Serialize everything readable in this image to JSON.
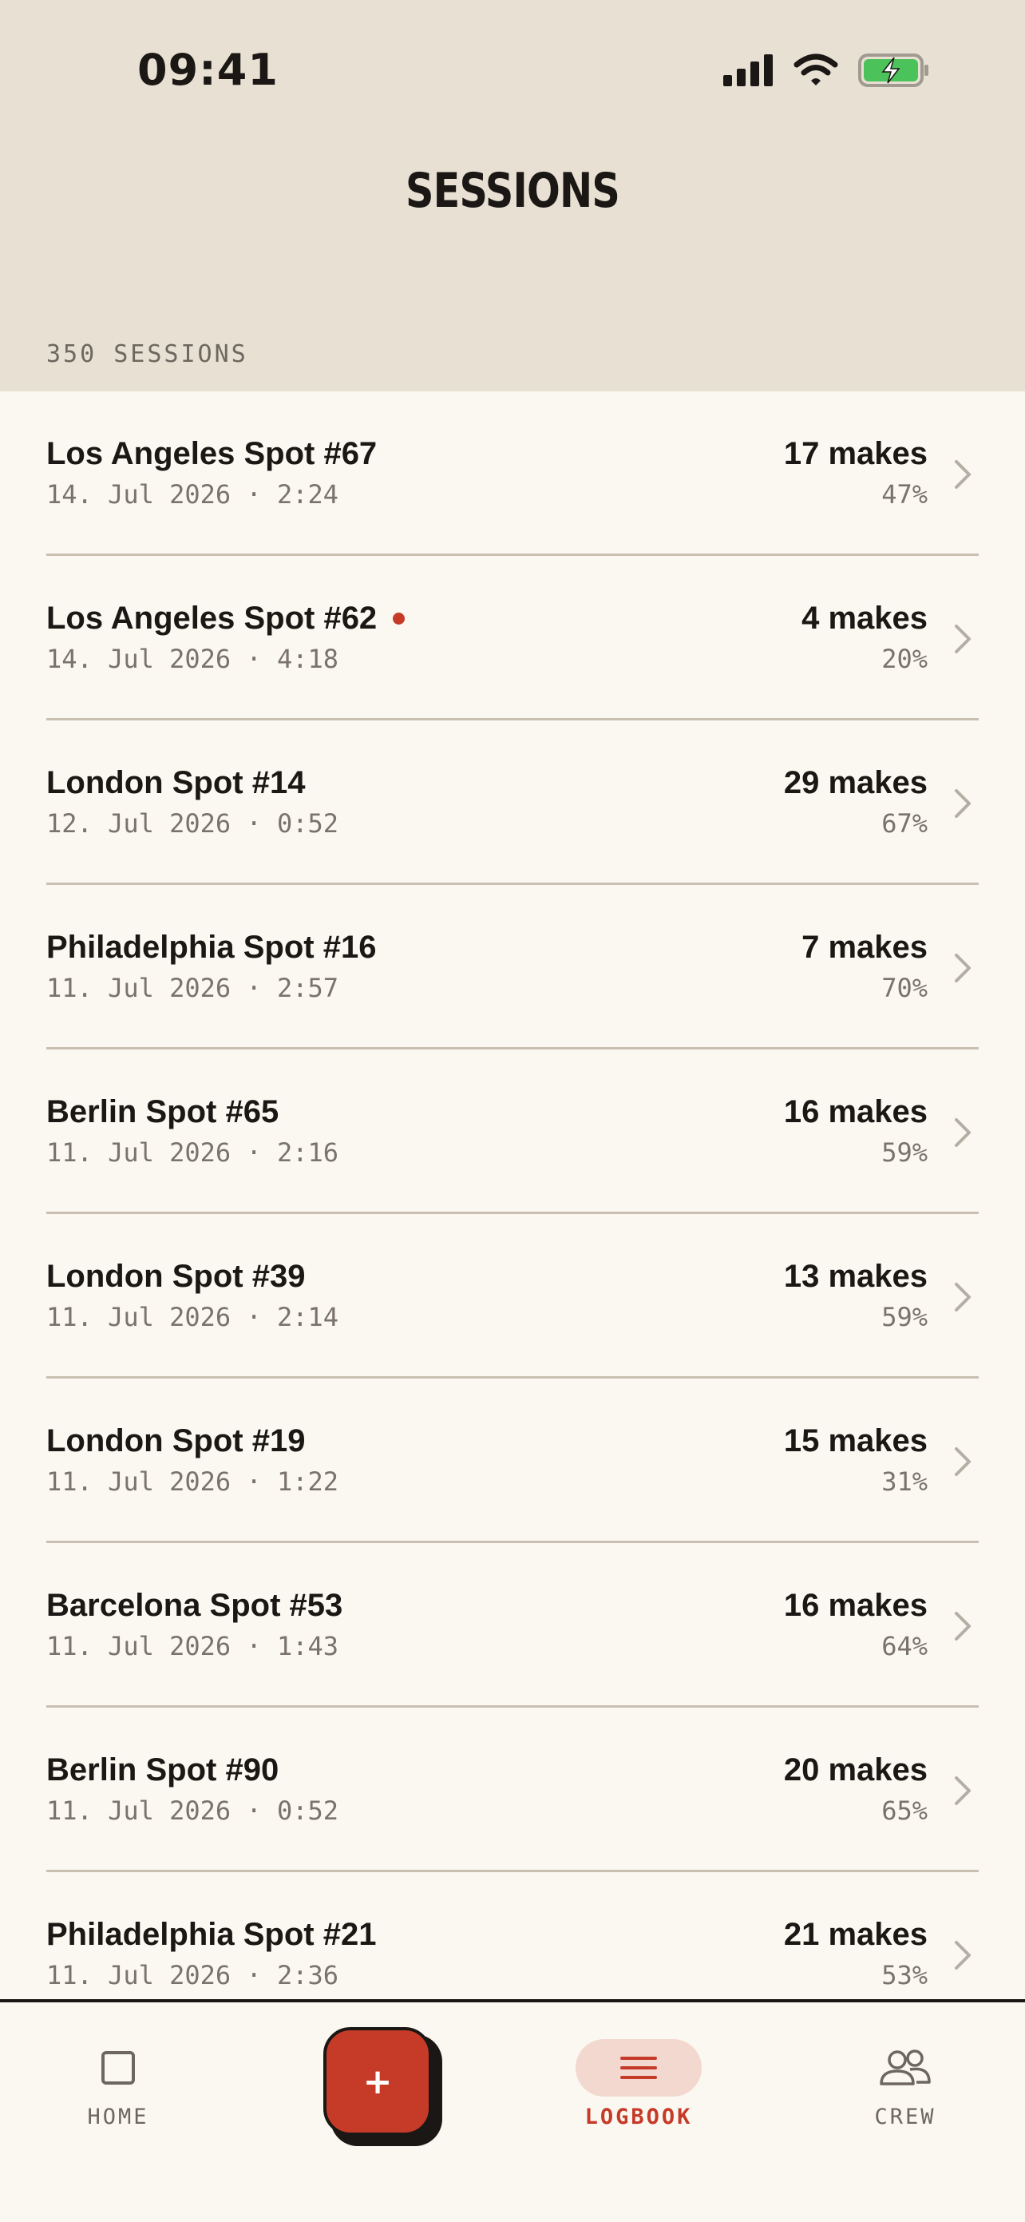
{
  "status": {
    "time": "09:41"
  },
  "header": {
    "title": "SESSIONS",
    "count": "350 SESSIONS"
  },
  "sessions": [
    {
      "name": "Los Angeles Spot #67",
      "date": "14. Jul 2026 · 2:24",
      "makes": "17 makes",
      "pct": "47%",
      "flag": false
    },
    {
      "name": "Los Angeles Spot #62",
      "date": "14. Jul 2026 · 4:18",
      "makes": "4 makes",
      "pct": "20%",
      "flag": true
    },
    {
      "name": "London Spot #14",
      "date": "12. Jul 2026 · 0:52",
      "makes": "29 makes",
      "pct": "67%",
      "flag": false
    },
    {
      "name": "Philadelphia Spot #16",
      "date": "11. Jul 2026 · 2:57",
      "makes": "7 makes",
      "pct": "70%",
      "flag": false
    },
    {
      "name": "Berlin Spot #65",
      "date": "11. Jul 2026 · 2:16",
      "makes": "16 makes",
      "pct": "59%",
      "flag": false
    },
    {
      "name": "London Spot #39",
      "date": "11. Jul 2026 · 2:14",
      "makes": "13 makes",
      "pct": "59%",
      "flag": false
    },
    {
      "name": "London Spot #19",
      "date": "11. Jul 2026 · 1:22",
      "makes": "15 makes",
      "pct": "31%",
      "flag": false
    },
    {
      "name": "Barcelona Spot #53",
      "date": "11. Jul 2026 · 1:43",
      "makes": "16 makes",
      "pct": "64%",
      "flag": false
    },
    {
      "name": "Berlin Spot #90",
      "date": "11. Jul 2026 · 0:52",
      "makes": "20 makes",
      "pct": "65%",
      "flag": false
    },
    {
      "name": "Philadelphia Spot #21",
      "date": "11. Jul 2026 · 2:36",
      "makes": "21 makes",
      "pct": "53%",
      "flag": false
    }
  ],
  "tabs": {
    "home": "HOME",
    "add": "+",
    "logbook": "LOGBOOK",
    "crew": "CREW"
  },
  "colors": {
    "accent": "#C63A28",
    "header_bg": "#E8E0D3",
    "page_bg": "#FAF8F0",
    "battery": "#4CC25A"
  }
}
